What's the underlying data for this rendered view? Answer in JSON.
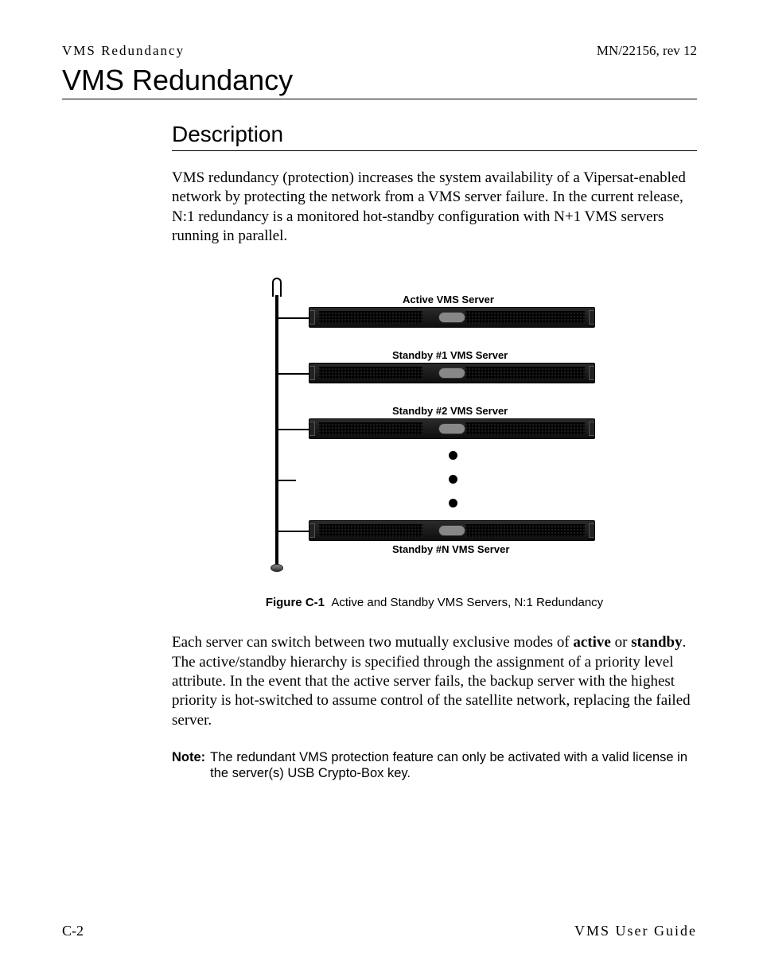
{
  "header": {
    "left": "VMS Redundancy",
    "right": "MN/22156, rev 12"
  },
  "title": "VMS Redundancy",
  "section_title": "Description",
  "para1": "VMS redundancy (protection) increases the system availability of a Vipersat-enabled network by protecting the network from a VMS server failure. In the current release, N:1 redundancy is a monitored hot-standby configuration with N+1 VMS servers running in parallel.",
  "diagram": {
    "labels": {
      "active": "Active VMS Server",
      "standby1": "Standby #1 VMS Server",
      "standby2": "Standby #2 VMS Server",
      "standbyN": "Standby #N VMS Server"
    }
  },
  "figure": {
    "id": "Figure C-1",
    "caption": "Active and Standby VMS Servers, N:1 Redundancy"
  },
  "para2_pre": "Each server can switch between two mutually exclusive modes of ",
  "para2_term1": "active",
  "para2_mid1": " or ",
  "para2_term2": "standby",
  "para2_post": ". The active/standby hierarchy is specified through the assignment of a priority level attribute. In the event that the active server fails, the backup server with the highest priority is hot-switched to assume control of the satellite network, replacing the failed server.",
  "note": {
    "label": "Note:",
    "text": "The redundant VMS protection feature can only be activated with a valid license in the server(s) USB Crypto-Box key."
  },
  "footer": {
    "left": "C-2",
    "right": "VMS User Guide"
  }
}
